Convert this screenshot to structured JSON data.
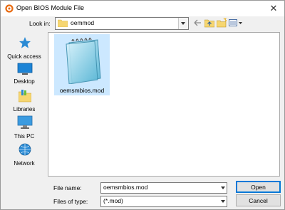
{
  "window": {
    "title": "Open BIOS Module File"
  },
  "lookin": {
    "label": "Look in:",
    "value": "oemmod"
  },
  "toolbar": {
    "icons": [
      "back-arrow-icon",
      "up-folder-icon",
      "new-folder-icon",
      "view-menu-icon"
    ]
  },
  "places": [
    {
      "label": "Quick access",
      "icon": "star-icon"
    },
    {
      "label": "Desktop",
      "icon": "desktop-icon"
    },
    {
      "label": "Libraries",
      "icon": "libraries-icon"
    },
    {
      "label": "This PC",
      "icon": "computer-icon"
    },
    {
      "label": "Network",
      "icon": "network-icon"
    }
  ],
  "files": [
    {
      "name": "oemsmbios.mod",
      "icon": "notepad-file-icon",
      "selected": true
    }
  ],
  "filename": {
    "label": "File name:",
    "value": "oemsmbios.mod"
  },
  "filetype": {
    "label": "Files of type:",
    "value": "(*.mod)"
  },
  "buttons": {
    "open": "Open",
    "cancel": "Cancel"
  },
  "colors": {
    "selection": "#cce8ff",
    "accent": "#0078d7",
    "folder": "#f6d671",
    "star": "#2a8ad4"
  }
}
